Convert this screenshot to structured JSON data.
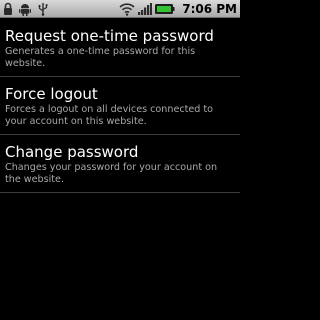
{
  "status_bar": {
    "time": "7:06 PM",
    "left_icons": [
      "lock-icon",
      "android-icon",
      "usb-icon"
    ],
    "right_icons": [
      "wifi-icon",
      "signal-icon",
      "battery-icon"
    ],
    "battery_color": "#34c234"
  },
  "settings_list": {
    "items": [
      {
        "title": "Request one-time password",
        "summary": "Generates a one-time password for this website."
      },
      {
        "title": "Force logout",
        "summary": "Forces a logout on all devices connected to your account on this website."
      },
      {
        "title": "Change password",
        "summary": "Changes your password for your account on the website."
      }
    ]
  }
}
